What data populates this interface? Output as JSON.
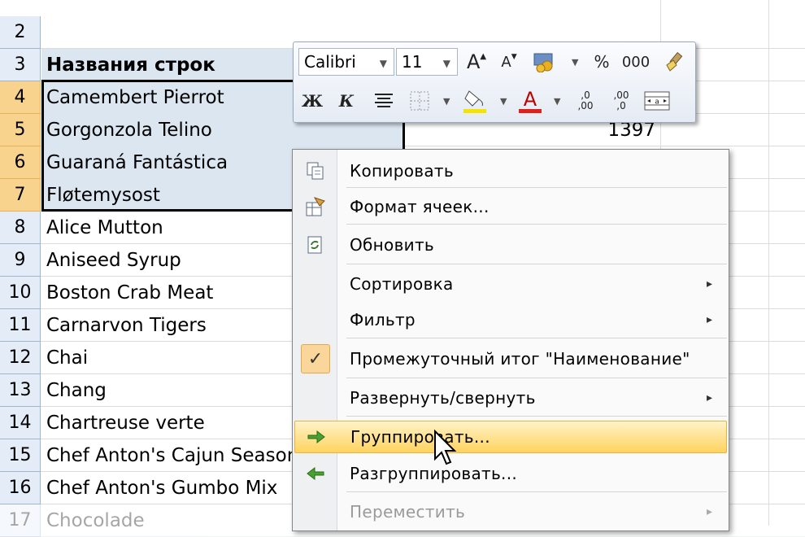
{
  "sheet": {
    "rows": [
      {
        "num": "2",
        "a": "",
        "b": ""
      },
      {
        "num": "3",
        "a": "Названия строк",
        "b": ""
      },
      {
        "num": "4",
        "a": "Camembert Pierrot",
        "b": ""
      },
      {
        "num": "5",
        "a": "Gorgonzola Telino",
        "b": "1397"
      },
      {
        "num": "6",
        "a": "Guaraná Fantástica",
        "b": ""
      },
      {
        "num": "7",
        "a": "Fløtemysost",
        "b": ""
      },
      {
        "num": "8",
        "a": "Alice Mutton",
        "b": ""
      },
      {
        "num": "9",
        "a": "Aniseed Syrup",
        "b": ""
      },
      {
        "num": "10",
        "a": "Boston Crab Meat",
        "b": ""
      },
      {
        "num": "11",
        "a": "Carnarvon Tigers",
        "b": ""
      },
      {
        "num": "12",
        "a": "Chai",
        "b": ""
      },
      {
        "num": "13",
        "a": "Chang",
        "b": ""
      },
      {
        "num": "14",
        "a": "Chartreuse verte",
        "b": ""
      },
      {
        "num": "15",
        "a": "Chef Anton's Cajun Seasoning",
        "b": ""
      },
      {
        "num": "16",
        "a": "Chef Anton's Gumbo Mix",
        "b": ""
      },
      {
        "num": "17",
        "a": "Chocolade",
        "b": ""
      }
    ]
  },
  "mini_toolbar": {
    "font_name": "Calibri",
    "font_size": "11",
    "bold": "Ж",
    "italic": "К",
    "percent": "%",
    "thousands": "000",
    "grow_font": "A",
    "shrink_font": "A",
    "font_color_letter": "A",
    "fill_color": "#f5e400",
    "font_color": "#e0201a",
    "inc_decimal": ",0 ,00",
    "dec_decimal": ",00 ,0"
  },
  "context_menu": {
    "items": [
      {
        "label": "Копировать",
        "icon": "copy-icon"
      },
      {
        "label": "Формат ячеек...",
        "icon": "format-cells-icon"
      },
      {
        "label": "Обновить",
        "icon": "refresh-icon"
      },
      {
        "label": "Сортировка",
        "submenu": "▸"
      },
      {
        "label": "Фильтр",
        "submenu": "▸"
      },
      {
        "label": "Промежуточный итог \"Наименование\"",
        "checked": "✓"
      },
      {
        "label": "Развернуть/свернуть",
        "submenu": "▸"
      },
      {
        "label": "Группировать...",
        "icon": "group-arrow-icon"
      },
      {
        "label": "Разгруппировать...",
        "icon": "ungroup-arrow-icon"
      },
      {
        "label": "Переместить",
        "submenu": "▸"
      }
    ]
  }
}
